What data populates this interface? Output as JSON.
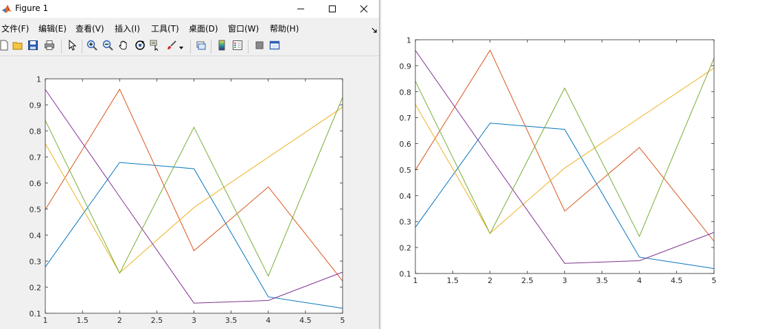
{
  "window": {
    "title": "Figure 1",
    "controls": {
      "minimize": "minimize",
      "maximize": "maximize",
      "close": "close"
    }
  },
  "menubar": {
    "items": [
      "文件(F)",
      "编辑(E)",
      "查看(V)",
      "插入(I)",
      "工具(T)",
      "桌面(D)",
      "窗口(W)",
      "帮助(H)"
    ]
  },
  "toolbar": {
    "buttons": [
      "new-figure-icon",
      "open-file-icon",
      "save-icon",
      "print-icon",
      "pointer-icon",
      "zoom-in-icon",
      "zoom-out-icon",
      "pan-hand-icon",
      "rotate-3d-icon",
      "data-cursor-icon",
      "brush-icon",
      "link-plot-icon",
      "colorbar-icon",
      "legend-icon",
      "hide-plot-tools-icon",
      "show-plot-tools-icon"
    ]
  },
  "colors": {
    "series1": "#0072BD",
    "series2": "#D95319",
    "series3": "#EDB120",
    "series4": "#7E2F8E",
    "series5": "#77AC30"
  },
  "chart_data": [
    {
      "type": "line",
      "location": "figure-window",
      "title": "",
      "xlabel": "",
      "ylabel": "",
      "xlim": [
        1,
        5
      ],
      "ylim": [
        0.1,
        1
      ],
      "x_ticks": [
        "1",
        "1.5",
        "2",
        "2.5",
        "3",
        "3.5",
        "4",
        "4.5",
        "5"
      ],
      "y_ticks": [
        "0.1",
        "0.2",
        "0.3",
        "0.4",
        "0.5",
        "0.6",
        "0.7",
        "0.8",
        "0.9",
        "1"
      ],
      "grid": false,
      "x": [
        1,
        2,
        3,
        4,
        5
      ],
      "series": [
        {
          "color": "#0072BD",
          "values": [
            0.278,
            0.679,
            0.655,
            0.163,
            0.119
          ]
        },
        {
          "color": "#D95319",
          "values": [
            0.498,
            0.96,
            0.34,
            0.585,
            0.224
          ]
        },
        {
          "color": "#EDB120",
          "values": [
            0.751,
            0.255,
            0.506,
            0.699,
            0.891
          ]
        },
        {
          "color": "#7E2F8E",
          "values": [
            0.959,
            0.547,
            0.139,
            0.149,
            0.258
          ]
        },
        {
          "color": "#77AC30",
          "values": [
            0.84,
            0.254,
            0.814,
            0.243,
            0.929
          ]
        }
      ]
    },
    {
      "type": "line",
      "location": "exported-image",
      "title": "",
      "xlabel": "",
      "ylabel": "",
      "xlim": [
        1,
        5
      ],
      "ylim": [
        0.1,
        1
      ],
      "x_ticks": [
        "1",
        "1.5",
        "2",
        "2.5",
        "3",
        "3.5",
        "4",
        "4.5",
        "5"
      ],
      "y_ticks": [
        "0.1",
        "0.2",
        "0.3",
        "0.4",
        "0.5",
        "0.6",
        "0.7",
        "0.8",
        "0.9",
        "1"
      ],
      "grid": false,
      "x": [
        1,
        2,
        3,
        4,
        5
      ],
      "series": [
        {
          "color": "#0072BD",
          "values": [
            0.278,
            0.679,
            0.655,
            0.163,
            0.119
          ]
        },
        {
          "color": "#D95319",
          "values": [
            0.498,
            0.96,
            0.34,
            0.585,
            0.224
          ]
        },
        {
          "color": "#EDB120",
          "values": [
            0.751,
            0.255,
            0.506,
            0.699,
            0.891
          ]
        },
        {
          "color": "#7E2F8E",
          "values": [
            0.959,
            0.547,
            0.139,
            0.149,
            0.258
          ]
        },
        {
          "color": "#77AC30",
          "values": [
            0.84,
            0.254,
            0.814,
            0.243,
            0.929
          ]
        }
      ]
    }
  ]
}
